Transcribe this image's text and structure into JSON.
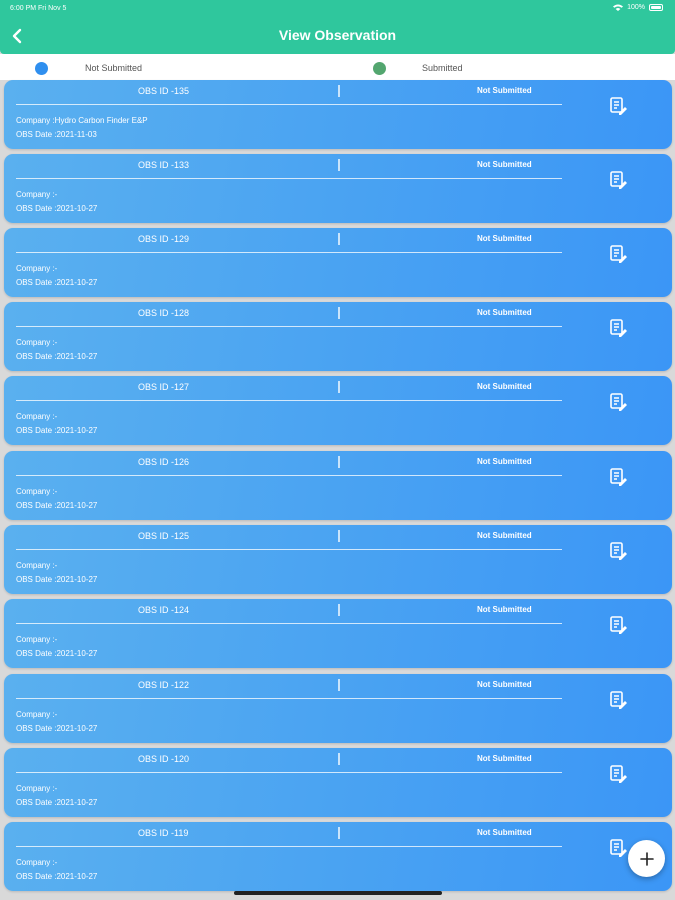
{
  "status_bar": {
    "time": "6:00 PM  Fri Nov 5",
    "battery": "100%"
  },
  "nav": {
    "title": "View Observation"
  },
  "legend": {
    "not_submitted": "Not Submitted",
    "submitted": "Submitted"
  },
  "colors": {
    "header": "#2fc79d",
    "card": "#4aa3f2",
    "not_submitted_dot": "#2f8fef",
    "submitted_dot": "#53a66f"
  },
  "observations": [
    {
      "id": "OBS ID -135",
      "status": "Not Submitted",
      "company": "Company :Hydro Carbon Finder E&P",
      "date": "OBS Date :2021-11-03"
    },
    {
      "id": "OBS ID -133",
      "status": "Not Submitted",
      "company": "Company :-",
      "date": "OBS Date :2021-10-27"
    },
    {
      "id": "OBS ID -129",
      "status": "Not Submitted",
      "company": "Company :-",
      "date": "OBS Date :2021-10-27"
    },
    {
      "id": "OBS ID -128",
      "status": "Not Submitted",
      "company": "Company :-",
      "date": "OBS Date :2021-10-27"
    },
    {
      "id": "OBS ID -127",
      "status": "Not Submitted",
      "company": "Company :-",
      "date": "OBS Date :2021-10-27"
    },
    {
      "id": "OBS ID -126",
      "status": "Not Submitted",
      "company": "Company :-",
      "date": "OBS Date :2021-10-27"
    },
    {
      "id": "OBS ID -125",
      "status": "Not Submitted",
      "company": "Company :-",
      "date": "OBS Date :2021-10-27"
    },
    {
      "id": "OBS ID -124",
      "status": "Not Submitted",
      "company": "Company :-",
      "date": "OBS Date :2021-10-27"
    },
    {
      "id": "OBS ID -122",
      "status": "Not Submitted",
      "company": "Company :-",
      "date": "OBS Date :2021-10-27"
    },
    {
      "id": "OBS ID -120",
      "status": "Not Submitted",
      "company": "Company :-",
      "date": "OBS Date :2021-10-27"
    },
    {
      "id": "OBS ID -119",
      "status": "Not Submitted",
      "company": "Company :-",
      "date": "OBS Date :2021-10-27"
    }
  ]
}
